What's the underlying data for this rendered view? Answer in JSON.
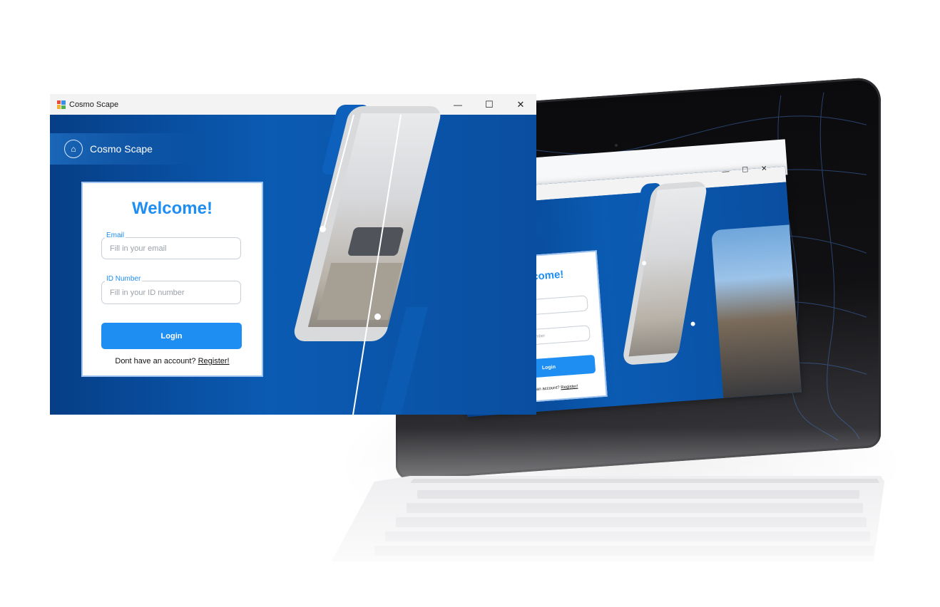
{
  "app": {
    "title": "Cosmo Scape",
    "brand_name": "Cosmo Scape",
    "welcome": "Welcome!",
    "email_label": "Email",
    "email_placeholder": "Fill in your email",
    "id_label": "ID Number",
    "id_placeholder": "Fill in your ID number",
    "login_label": "Login",
    "register_prompt": "Dont have an account?",
    "register_link": "Register!"
  },
  "window_controls": {
    "minimize": "—",
    "maximize": "☐",
    "close": "✕"
  },
  "colors": {
    "primary": "#1e8ef2",
    "background_blue": "#0a4ea0",
    "titlebar": "#f3f3f3"
  },
  "icons": {
    "brand": "building-icon",
    "app": "app-window-icon"
  }
}
